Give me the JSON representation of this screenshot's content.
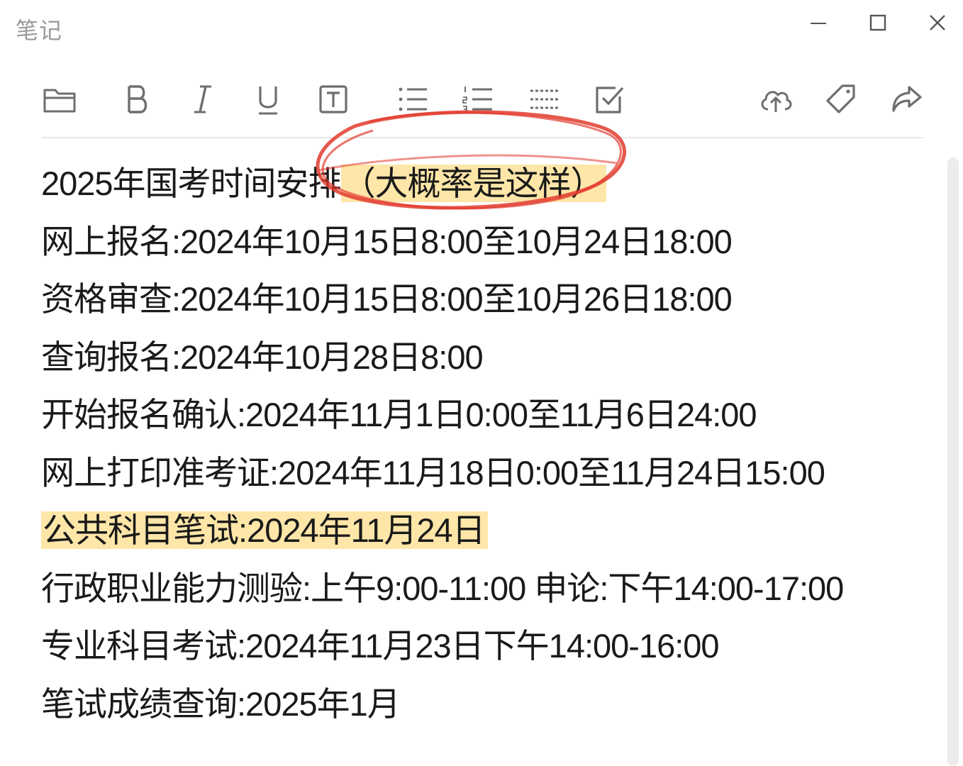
{
  "window": {
    "title": "笔记",
    "controls": [
      "minimize-icon",
      "maximize-icon",
      "close-icon"
    ]
  },
  "toolbar": {
    "tools": [
      "folder-icon",
      "bold-icon",
      "italic-icon",
      "underline-icon",
      "text-box-icon",
      "bullet-list-icon",
      "numbered-list-icon",
      "divider-line-icon",
      "checkbox-icon",
      "cloud-upload-icon",
      "tag-icon",
      "share-icon"
    ]
  },
  "note": {
    "title_text": "2025年国考时间安排",
    "title_highlight": "（大概率是这样）",
    "lines": [
      "网上报名:2024年10月15日8:00至10月24日18:00",
      "资格审查:2024年10月15日8:00至10月26日18:00",
      "查询报名:2024年10月28日8:00",
      "开始报名确认:2024年11月1日0:00至11月6日24:00",
      "网上打印准考证:2024年11月18日0:00至11月24日15:00"
    ],
    "highlight_line": "公共科目笔试:2024年11月24日",
    "lines_after": [
      "行政职业能力测验:上午9:00-11:00 申论:下午14:00-17:00",
      "专业科目考试:2024年11月23日下午14:00-16:00",
      "笔试成绩查询:2025年1月"
    ]
  },
  "colors": {
    "highlight": "#fde6a8",
    "annotation_circle": "#e23b2e",
    "title_gray": "#9a9a9a",
    "icon_gray": "#6e6e6e"
  }
}
